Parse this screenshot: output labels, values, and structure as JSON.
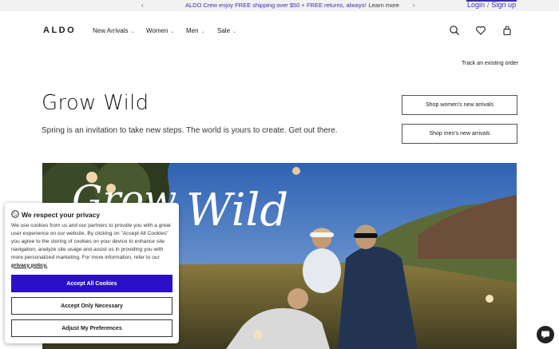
{
  "promo": {
    "message": "ALDO Crew enjoy FREE shipping over $50 + FREE returns, always!",
    "learn_more": "Learn more",
    "prev_icon": "chevron-left-icon",
    "next_icon": "chevron-right-icon"
  },
  "auth": {
    "login": "Login",
    "separator": "/",
    "signup": "Sign up"
  },
  "header": {
    "logo": "ALDO",
    "nav": [
      {
        "label": "New Arrivals"
      },
      {
        "label": "Women"
      },
      {
        "label": "Men"
      },
      {
        "label": "Sale"
      }
    ],
    "icons": [
      "search-icon",
      "heart-icon",
      "bag-icon"
    ]
  },
  "track_order": "Track an existing order",
  "hero": {
    "title": "Grow Wild",
    "subtitle": "Spring is an invitation to take new steps. The world is yours to create. Get out there.",
    "cta_women": "Shop women's new arrivals",
    "cta_men": "Shop men's new arrivals",
    "image_text": "Wild",
    "image_text_partial": "Grow"
  },
  "cookie": {
    "title": "We respect your privacy",
    "body": "We use cookies from us and our partners to provide you with a great user experience on our website. By clicking on \"Accept All Cookies\" you agree to the storing of cookies on your device to enhance site navigation, analyze site usage and assist us in providing you with more personalized marketing. For more information, refer to our",
    "policy_link": "privacy policy.",
    "accept_all": "Accept All Cookies",
    "accept_necessary": "Accept Only Necessary",
    "adjust": "Adjust My Preferences",
    "icon": "cookie-icon"
  },
  "colors": {
    "accent": "#2b0fc9",
    "promo_text": "#3b2db0"
  }
}
